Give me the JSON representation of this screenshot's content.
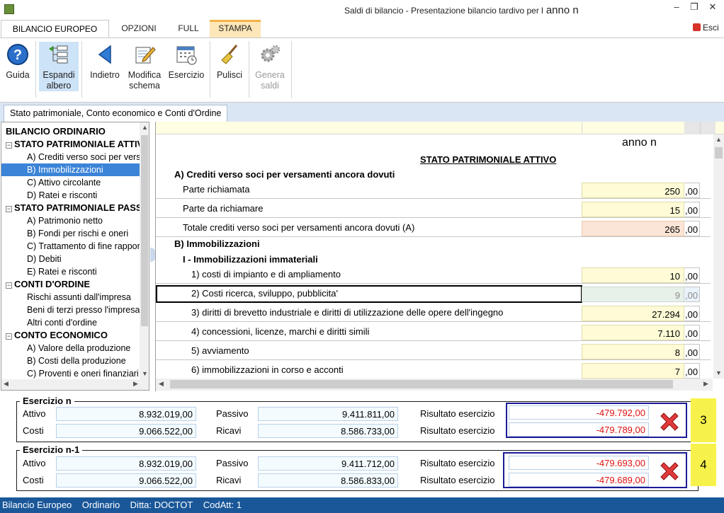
{
  "window": {
    "title": "Saldi di bilancio - Presentazione bilancio tardivo per l",
    "title_anno": "anno n",
    "exit_label": "Esci"
  },
  "ribbon_tabs": [
    "BILANCIO EUROPEO",
    "OPZIONI",
    "FULL",
    "STAMPA"
  ],
  "ribbon_buttons": {
    "guida": [
      "Guida"
    ],
    "espandi": [
      "Espandi",
      "albero"
    ],
    "indietro": [
      "Indietro"
    ],
    "modifica": [
      "Modifica",
      "schema"
    ],
    "esercizio": [
      "Esercizio"
    ],
    "pulisci": [
      "Pulisci"
    ],
    "genera": [
      "Genera",
      "saldi"
    ]
  },
  "content_tab": "Stato patrimoniale, Conto economico e Conti d'Ordine",
  "tree": [
    "BILANCIO ORDINARIO",
    "STATO PATRIMONIALE ATTIVO",
    "A) Crediti verso soci per versamenti ancora dovuti",
    "B) Immobilizzazioni",
    "C) Attivo circolante",
    "D) Ratei e risconti",
    "STATO PATRIMONIALE PASSIVO",
    "A) Patrimonio netto",
    "B) Fondi per rischi e oneri",
    "C) Trattamento di fine rapporto",
    "D) Debiti",
    "E) Ratei e risconti",
    "CONTI D'ORDINE",
    "Rischi assunti dall'impresa",
    "Beni di terzi presso l'impresa",
    "Altri conti d'ordine",
    "CONTO ECONOMICO",
    "A) Valore della produzione",
    "B) Costi della produzione",
    "C) Proventi e oneri finanziari"
  ],
  "grid": {
    "column_header": "anno n",
    "section_title": "STATO PATRIMONIALE ATTIVO",
    "decimals": ",00",
    "rows": [
      {
        "label": "A) Crediti verso soci per versamenti ancora dovuti",
        "value": ""
      },
      {
        "label": "Parte richiamata",
        "value": "250"
      },
      {
        "label": "Parte da richiamare",
        "value": "15"
      },
      {
        "label": "Totale crediti verso soci per versamenti ancora dovuti (A)",
        "value": "265"
      },
      {
        "label": "B) Immobilizzazioni",
        "value": ""
      },
      {
        "label": "I - Immobilizzazioni immateriali",
        "value": ""
      },
      {
        "label": "1) costi di impianto e di ampliamento",
        "value": "10"
      },
      {
        "label": "2) Costi ricerca, sviluppo, pubblicita'",
        "value": "9"
      },
      {
        "label": "3) diritti di brevetto industriale e diritti di utilizzazione delle opere dell'ingegno",
        "value": "27.294"
      },
      {
        "label": "4) concessioni, licenze, marchi e diritti simili",
        "value": "7.110"
      },
      {
        "label": "5) avviamento",
        "value": "8"
      },
      {
        "label": "6) immobilizzazioni in corso e acconti",
        "value": "7"
      }
    ]
  },
  "summary": [
    {
      "title": "Esercizio n",
      "attivo_label": "Attivo",
      "attivo": "8.932.019,00",
      "passivo_label": "Passivo",
      "passivo": "9.411.811,00",
      "costi_label": "Costi",
      "costi": "9.066.522,00",
      "ricavi_label": "Ricavi",
      "ricavi": "8.586.733,00",
      "risultato_label": "Risultato esercizio",
      "risultato_1": "-479.792,00",
      "risultato_2": "-479.789,00",
      "badge": "3"
    },
    {
      "title": "Esercizio n-1",
      "attivo_label": "Attivo",
      "attivo": "8.932.019,00",
      "passivo_label": "Passivo",
      "passivo": "9.411.712,00",
      "costi_label": "Costi",
      "costi": "9.066.522,00",
      "ricavi_label": "Ricavi",
      "ricavi": "8.586.833,00",
      "risultato_label": "Risultato esercizio",
      "risultato_1": "-479.693,00",
      "risultato_2": "-479.689,00",
      "badge": "4"
    }
  ],
  "status_bar": [
    "Bilancio Europeo",
    "Ordinario",
    "Ditta: DOCTOT",
    "CodAtt: 1"
  ],
  "colors": {
    "accent": "#3b84d8",
    "status_bar": "#1a5799",
    "stampa_tab": "#fde6b8",
    "value_cell": "#fefbd6",
    "negative": "#d11111",
    "badge": "#f7f24b"
  }
}
